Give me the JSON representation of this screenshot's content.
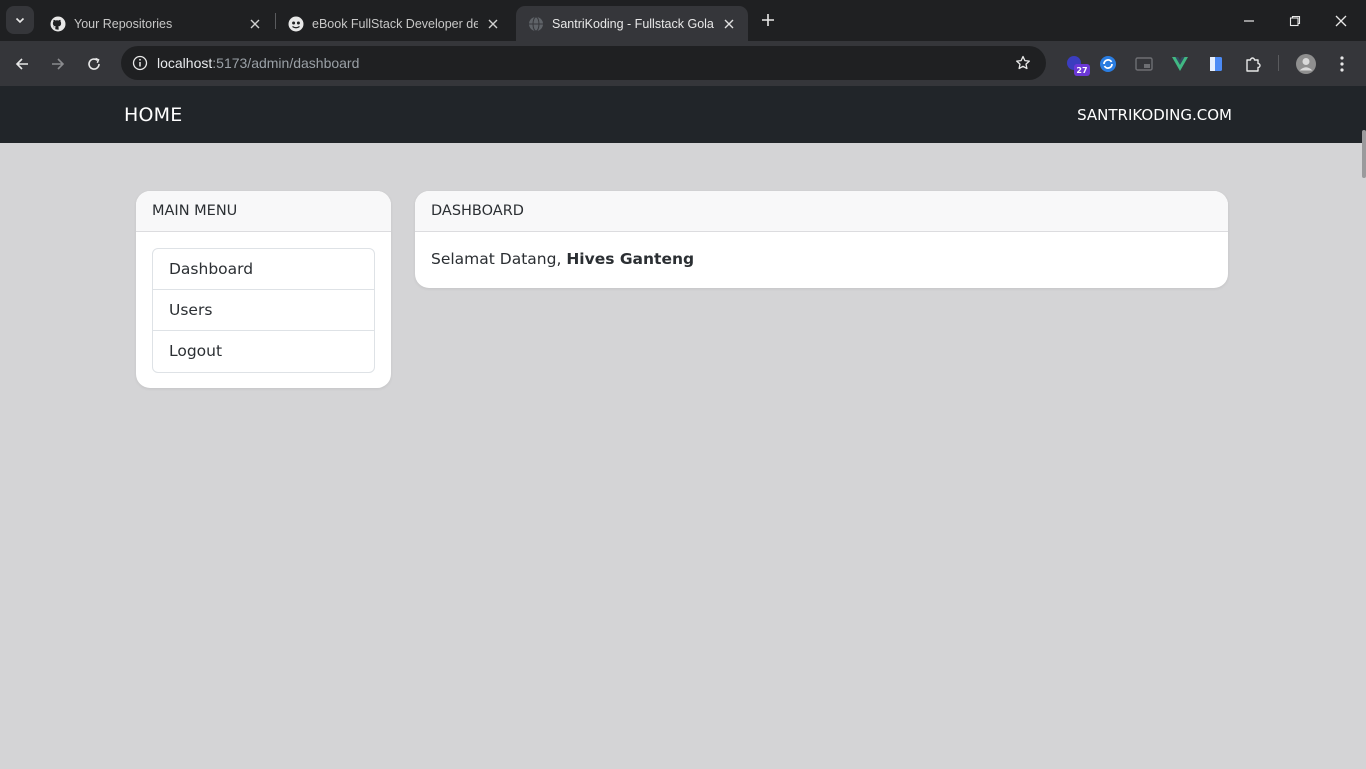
{
  "browser": {
    "tabs": [
      {
        "title": "Your Repositories",
        "favicon": "github-icon",
        "active": false
      },
      {
        "title": "eBook FullStack Developer dengan",
        "favicon": "ebook-icon",
        "active": false
      },
      {
        "title": "SantriKoding - Fullstack Golang",
        "favicon": "globe-icon",
        "active": true
      }
    ],
    "address": {
      "host": "localhost",
      "path": ":5173/admin/dashboard"
    },
    "extensions": [
      {
        "name": "calendar-extension-icon",
        "badge": "27"
      },
      {
        "name": "sync-extension-icon"
      },
      {
        "name": "picture-in-picture-icon"
      },
      {
        "name": "vue-devtools-icon"
      },
      {
        "name": "document-extension-icon"
      },
      {
        "name": "puzzle-extensions-icon"
      }
    ],
    "colors": {
      "tabstrip": "#1f2022",
      "toolbar": "#35363a",
      "omnibox": "#1f2022"
    }
  },
  "app": {
    "navbar": {
      "brand": "HOME",
      "site_link": "SANTRIKODING.COM",
      "color": "#212529"
    },
    "sidebar": {
      "title": "MAIN MENU",
      "items": [
        {
          "label": "Dashboard"
        },
        {
          "label": "Users"
        },
        {
          "label": "Logout"
        }
      ]
    },
    "dashboard": {
      "title": "DASHBOARD",
      "welcome_prefix": "Selamat Datang, ",
      "user_name": "Hives Ganteng"
    },
    "background": "#d4d4d6"
  }
}
